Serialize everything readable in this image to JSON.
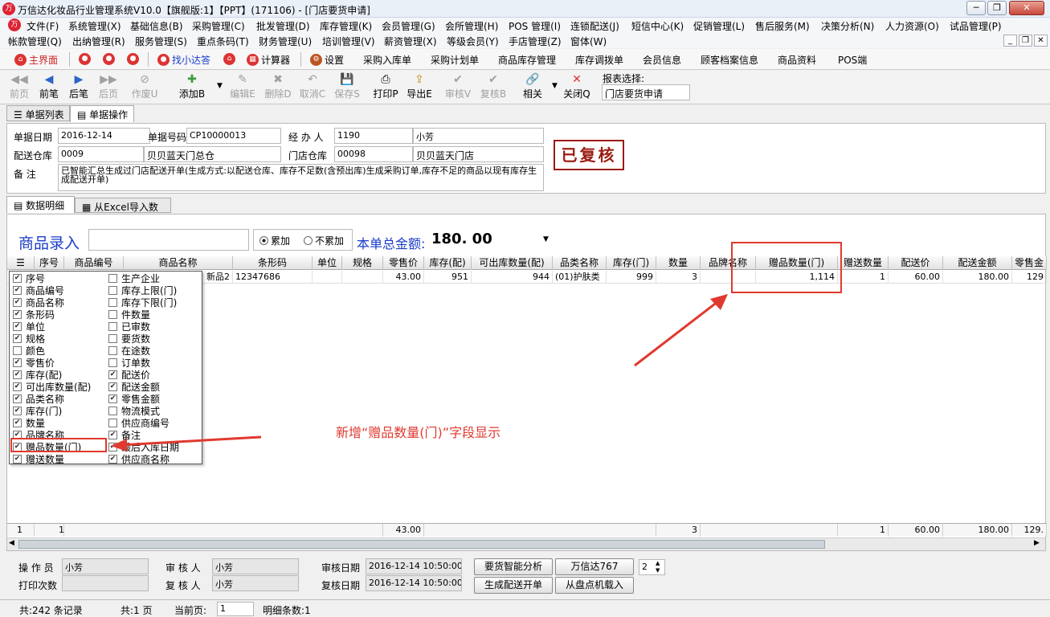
{
  "window": {
    "title": "万信达化妆品行业管理系统V10.0【旗舰版:1】【PPT】(171106) - [门店要货申请]",
    "min": "─",
    "restore": "❐",
    "close": "✕"
  },
  "menus": {
    "row1": [
      "文件(F)",
      "系统管理(X)",
      "基础信息(B)",
      "采购管理(C)",
      "批发管理(D)",
      "库存管理(K)",
      "会员管理(G)",
      "会所管理(H)",
      "POS 管理(I)",
      "连锁配送(J)",
      "短信中心(K)",
      "促销管理(L)",
      "售后服务(M)",
      "决策分析(N)",
      "人力资源(O)",
      "试品管理(P)"
    ],
    "row2": [
      "帐款管理(Q)",
      "出纳管理(R)",
      "服务管理(S)",
      "重点条码(T)",
      "财务管理(U)",
      "培训管理(V)",
      "薪资管理(X)",
      "等级会员(Y)",
      "手店管理(Z)",
      "窗体(W)"
    ]
  },
  "quickbar": {
    "home": "主界面",
    "finder": "找小达答",
    "calc": "计算器",
    "settings": "设置",
    "links": [
      "采购入库单",
      "采购计划单",
      "商品库存管理",
      "库存调拨单",
      "会员信息",
      "顾客档案信息",
      "商品资料",
      "POS端"
    ]
  },
  "toolbar": {
    "buttons": [
      {
        "label": "前页",
        "icon": "◀◀"
      },
      {
        "label": "前笔",
        "icon": "◀"
      },
      {
        "label": "后笔",
        "icon": "▶"
      },
      {
        "label": "后页",
        "icon": "▶▶"
      },
      {
        "label": "作废U",
        "icon": "⊘"
      },
      {
        "label": "添加B",
        "icon": "✚"
      },
      {
        "label": "编辑E",
        "icon": "✎"
      },
      {
        "label": "删除D",
        "icon": "✖"
      },
      {
        "label": "取消C",
        "icon": "↶"
      },
      {
        "label": "保存S",
        "icon": "💾"
      },
      {
        "label": "打印P",
        "icon": "⎙"
      },
      {
        "label": "导出E",
        "icon": "⇪"
      },
      {
        "label": "审核V",
        "icon": "✔"
      },
      {
        "label": "复核B",
        "icon": "✔"
      },
      {
        "label": "相关",
        "icon": "🔗"
      },
      {
        "label": "关闭Q",
        "icon": "✕"
      }
    ],
    "report_label": "报表选择:",
    "report_value": "门店要货申请"
  },
  "tabs": [
    "单据列表",
    "单据操作"
  ],
  "form": {
    "date_label": "单据日期",
    "date": "2016-12-14",
    "code_label": "单据号码",
    "code": "CP10000013",
    "handler_label": "经 办 人",
    "handler_id": "1190",
    "handler_name": "小芳",
    "wh_label": "配送仓库",
    "wh_id": "0009",
    "wh_name": "贝贝蓝天门总仓",
    "store_label": "门店仓库",
    "store_id": "00098",
    "store_name": "贝贝蓝天门店",
    "note_label": "备    注",
    "note": "已智能汇总生成过门店配送开单(生成方式:以配送仓库、库存不足数(含预出库)生成采购订单,库存不足的商品以现有库存生成配送开单)",
    "stamp": "已复核"
  },
  "subtabs": [
    "数据明细",
    "从Excel导入数据"
  ],
  "entry": {
    "label": "商品录入",
    "opt_add": "累加",
    "opt_noadd": "不累加",
    "total_label": "本单总金额:",
    "total": "180. 00"
  },
  "grid": {
    "headers": [
      "序号",
      "商品编号",
      "商品名称",
      "条形码",
      "单位",
      "规格",
      "零售价",
      "库存(配)",
      "可出库数量(配)",
      "品类名称",
      "库存(门)",
      "数量",
      "品牌名称",
      "赠品数量(门)",
      "赠送数量",
      "配送价",
      "配送金额",
      "零售金"
    ],
    "row": [
      "",
      "",
      "新品2",
      "12347686",
      "",
      "",
      "43.00",
      "951",
      "944",
      "(01)护肤类",
      "999",
      "3",
      "",
      "1,114",
      "1",
      "60.00",
      "180.00",
      "129"
    ],
    "footer": {
      "idx": "1",
      "seq": "1",
      "retail": "43.00",
      "qty": "3",
      "gift": "1",
      "price": "60.00",
      "amount": "180.00",
      "retail_total": "129."
    }
  },
  "columns_popup": {
    "left": [
      {
        "label": "序号",
        "checked": true
      },
      {
        "label": "商品编号",
        "checked": true
      },
      {
        "label": "商品名称",
        "checked": true
      },
      {
        "label": "条形码",
        "checked": true
      },
      {
        "label": "单位",
        "checked": true
      },
      {
        "label": "规格",
        "checked": true
      },
      {
        "label": "颜色",
        "checked": false
      },
      {
        "label": "零售价",
        "checked": true
      },
      {
        "label": "库存(配)",
        "checked": true
      },
      {
        "label": "可出库数量(配)",
        "checked": true
      },
      {
        "label": "品类名称",
        "checked": true
      },
      {
        "label": "库存(门)",
        "checked": true
      },
      {
        "label": "数量",
        "checked": true
      },
      {
        "label": "品牌名称",
        "checked": true
      },
      {
        "label": "赠品数量(门)",
        "checked": true
      },
      {
        "label": "赠送数量",
        "checked": true
      }
    ],
    "right": [
      {
        "label": "生产企业",
        "checked": false
      },
      {
        "label": "库存上限(门)",
        "checked": false
      },
      {
        "label": "库存下限(门)",
        "checked": false
      },
      {
        "label": "件数量",
        "checked": false
      },
      {
        "label": "已审数",
        "checked": false
      },
      {
        "label": "要货数",
        "checked": false
      },
      {
        "label": "在途数",
        "checked": false
      },
      {
        "label": "订单数",
        "checked": false
      },
      {
        "label": "配送价",
        "checked": true
      },
      {
        "label": "配送金额",
        "checked": true
      },
      {
        "label": "零售金额",
        "checked": true
      },
      {
        "label": "物流模式",
        "checked": false
      },
      {
        "label": "供应商编号",
        "checked": false
      },
      {
        "label": "备注",
        "checked": true
      },
      {
        "label": "最后入库日期",
        "checked": true
      },
      {
        "label": "供应商名称",
        "checked": true
      }
    ]
  },
  "annotation": "新增“赠品数量(门)”字段显示",
  "bottom": {
    "operator_label": "操 作 员",
    "operator": "小芳",
    "print_label": "打印次数",
    "print_count": "",
    "auditor_label": "审 核 人",
    "auditor": "小芳",
    "reviewer_label": "复 核 人",
    "reviewer": "小芳",
    "audit_date_label": "审核日期",
    "audit_date": "2016-12-14 10:50:00",
    "review_date_label": "复核日期",
    "review_date": "2016-12-14 10:50:00",
    "btn_analysis": "要货智能分析",
    "btn_wxd": "万信达767",
    "spin_value": "2",
    "btn_gen": "生成配送开单",
    "btn_load": "从盘点机载入"
  },
  "status": {
    "records": "共:242 条记录",
    "pages": "共:1 页",
    "current_label": "当前页:",
    "current": "1",
    "details": "明细条数:1"
  },
  "colors": {
    "accent": "#e03a2f",
    "stamp": "#9b1c12",
    "link_blue": "#1a3cc8"
  }
}
